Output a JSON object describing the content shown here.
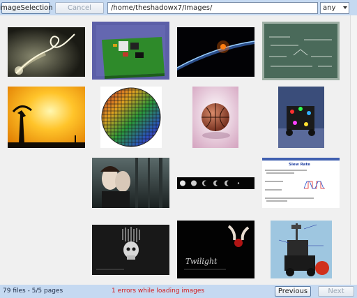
{
  "toolbar": {
    "select_label": "imageSelection",
    "cancel_label": "Cancel",
    "path_value": "/home/theshadowx7/Images/",
    "filter_value": "any"
  },
  "status": {
    "summary": "79 files - 5/5 pages",
    "error": "1 errors while loading images",
    "previous_label": "Previous",
    "next_label": "Next"
  },
  "thumbnails": [
    {
      "name": "thumb-light-swirl"
    },
    {
      "name": "thumb-circuit-board"
    },
    {
      "name": "thumb-earth-horizon"
    },
    {
      "name": "thumb-chalkboard"
    },
    {
      "name": "thumb-sunset-silhouette"
    },
    {
      "name": "thumb-silicon-wafer"
    },
    {
      "name": "thumb-basketball"
    },
    {
      "name": "thumb-robot-leds"
    },
    {
      "name": "thumb-twilight-poster"
    },
    {
      "name": "thumb-moon-phases"
    },
    {
      "name": "thumb-slew-rate-slide",
      "title": "Slew Rate"
    },
    {
      "name": "thumb-skull-art"
    },
    {
      "name": "thumb-twilight-apple",
      "title": "Twilight"
    },
    {
      "name": "thumb-robot-diagram"
    }
  ]
}
